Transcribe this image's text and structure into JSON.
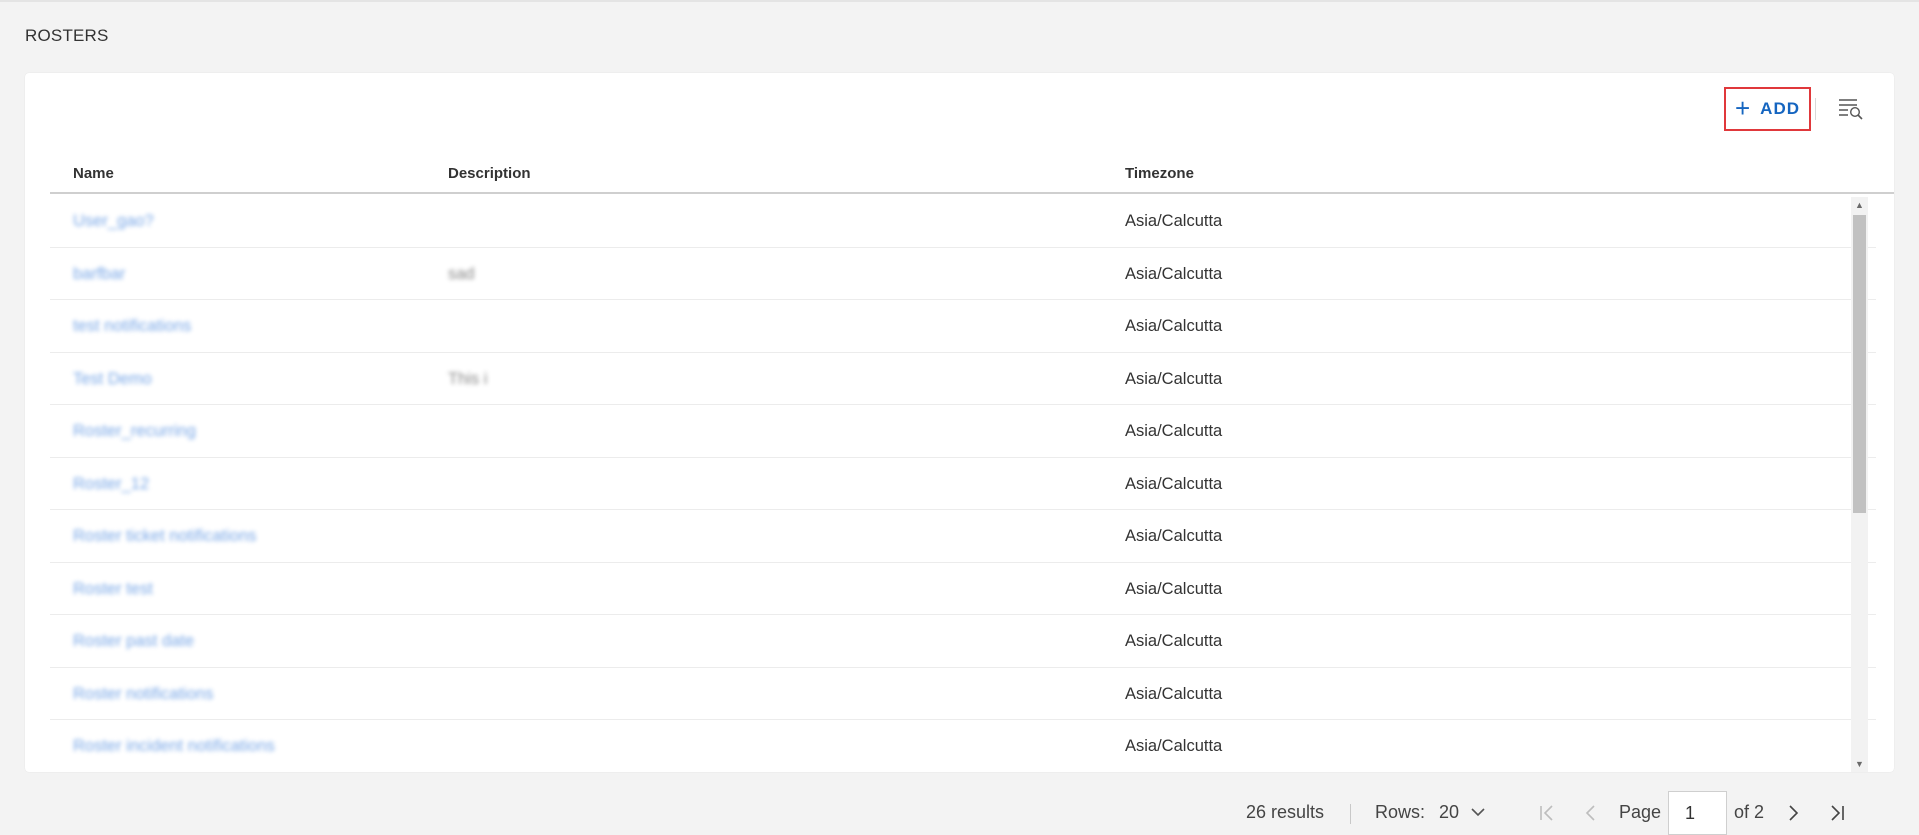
{
  "page": {
    "title": "ROSTERS"
  },
  "toolbar": {
    "add_label": "ADD",
    "add_icon": "plus-icon",
    "filter_icon": "filter-search-icon"
  },
  "table": {
    "columns": {
      "name": "Name",
      "description": "Description",
      "timezone": "Timezone"
    },
    "rows": [
      {
        "name": "User_gao?",
        "description": "",
        "timezone": "Asia/Calcutta"
      },
      {
        "name": "barfbar",
        "description": "sad",
        "timezone": "Asia/Calcutta"
      },
      {
        "name": "test notifications",
        "description": "",
        "timezone": "Asia/Calcutta"
      },
      {
        "name": "Test Demo",
        "description": "This i",
        "timezone": "Asia/Calcutta"
      },
      {
        "name": "Roster_recurring",
        "description": "",
        "timezone": "Asia/Calcutta"
      },
      {
        "name": "Roster_12",
        "description": "",
        "timezone": "Asia/Calcutta"
      },
      {
        "name": "Roster ticket notifications",
        "description": "",
        "timezone": "Asia/Calcutta"
      },
      {
        "name": "Roster test",
        "description": "",
        "timezone": "Asia/Calcutta"
      },
      {
        "name": "Roster past date",
        "description": "",
        "timezone": "Asia/Calcutta"
      },
      {
        "name": "Roster notifications",
        "description": "",
        "timezone": "Asia/Calcutta"
      },
      {
        "name": "Roster incident notifications",
        "description": "",
        "timezone": "Asia/Calcutta"
      }
    ]
  },
  "footer": {
    "results": "26 results",
    "rows_label": "Rows:",
    "rows_value": "20",
    "page_label": "Page",
    "page_value": "1",
    "of_total": "of 2"
  },
  "colors": {
    "link": "#1e6bd6",
    "add_button_text": "#1565c0",
    "highlight_border": "#e0383b",
    "background": "#f3f3f3"
  }
}
